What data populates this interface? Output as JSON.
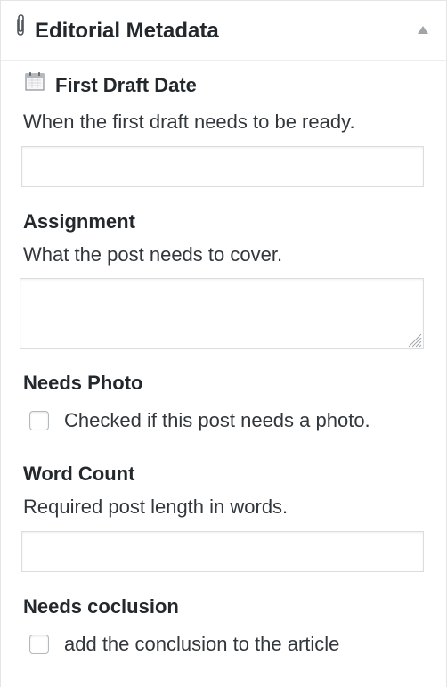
{
  "panel": {
    "title": "Editorial Metadata",
    "icon": "paperclip-icon",
    "toggle_icon": "collapse-arrow-icon"
  },
  "fields": {
    "first_draft": {
      "icon": "calendar-icon",
      "label": "First Draft Date",
      "description": "When the first draft needs to be ready.",
      "value": ""
    },
    "assignment": {
      "label": "Assignment",
      "description": "What the post needs to cover.",
      "value": ""
    },
    "needs_photo": {
      "label": "Needs Photo",
      "checkbox_label": "Checked if this post needs a photo.",
      "checked": false
    },
    "word_count": {
      "label": "Word Count",
      "description": "Required post length in words.",
      "value": ""
    },
    "needs_conclusion": {
      "label": "Needs coclusion",
      "checkbox_label": "add the conclusion to the article",
      "checked": false
    }
  },
  "colors": {
    "text": "#23282d",
    "border": "#dddddd",
    "arrow": "#a0a5aa"
  }
}
